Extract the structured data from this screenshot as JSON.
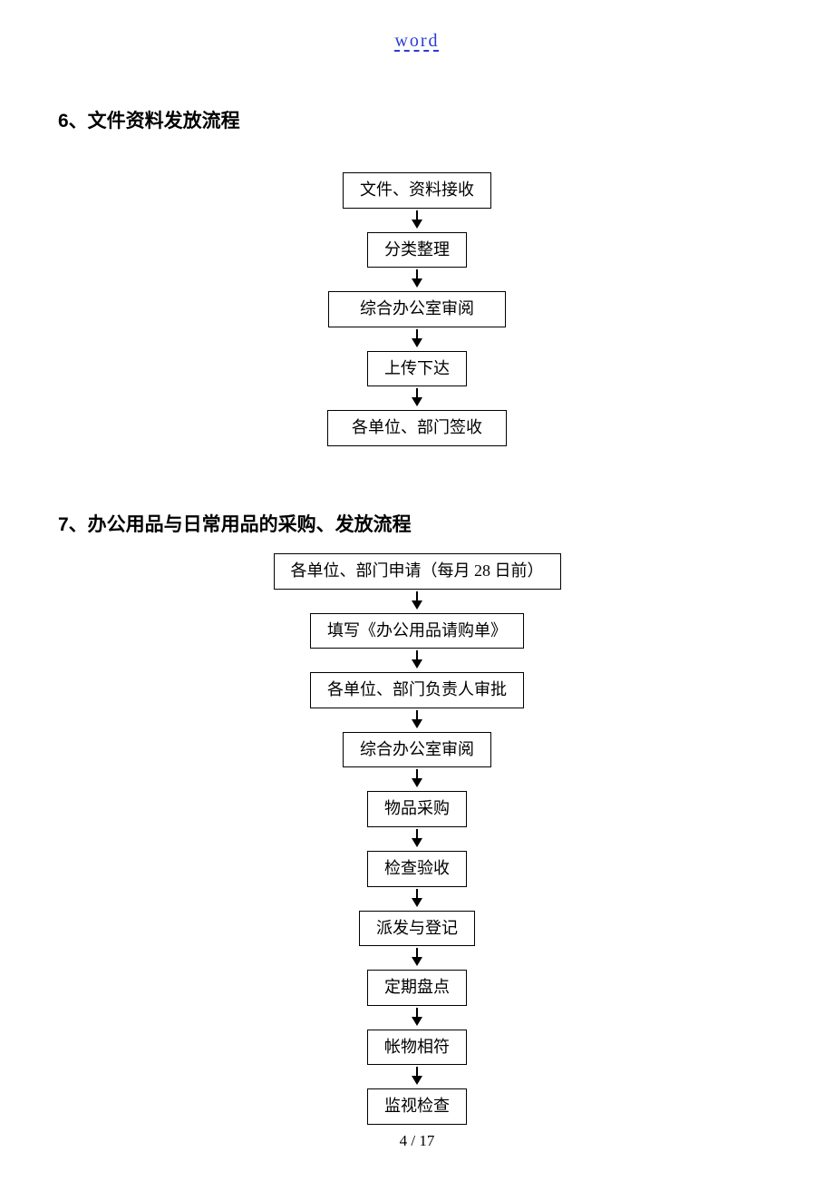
{
  "header": {
    "link": "word"
  },
  "section6": {
    "title": "6、文件资料发放流程",
    "steps": [
      "文件、资料接收",
      "分类整理",
      "综合办公室审阅",
      "上传下达",
      "各单位、部门签收"
    ]
  },
  "section7": {
    "title": "7、办公用品与日常用品的采购、发放流程",
    "steps": [
      "各单位、部门申请（每月 28 日前）",
      "填写《办公用品请购单》",
      "各单位、部门负责人审批",
      "综合办公室审阅",
      "物品采购",
      "检查验收",
      "派发与登记",
      "定期盘点",
      "帐物相符",
      "监视检查"
    ]
  },
  "footer": {
    "page": "4 / 17"
  },
  "chart_data": [
    {
      "type": "flowchart",
      "title": "文件资料发放流程",
      "nodes": [
        "文件、资料接收",
        "分类整理",
        "综合办公室审阅",
        "上传下达",
        "各单位、部门签收"
      ],
      "edges": [
        [
          0,
          1
        ],
        [
          1,
          2
        ],
        [
          2,
          3
        ],
        [
          3,
          4
        ]
      ]
    },
    {
      "type": "flowchart",
      "title": "办公用品与日常用品的采购、发放流程",
      "nodes": [
        "各单位、部门申请（每月 28 日前）",
        "填写《办公用品请购单》",
        "各单位、部门负责人审批",
        "综合办公室审阅",
        "物品采购",
        "检查验收",
        "派发与登记",
        "定期盘点",
        "帐物相符",
        "监视检查"
      ],
      "edges": [
        [
          0,
          1
        ],
        [
          1,
          2
        ],
        [
          2,
          3
        ],
        [
          3,
          4
        ],
        [
          4,
          5
        ],
        [
          5,
          6
        ],
        [
          6,
          7
        ],
        [
          7,
          8
        ],
        [
          8,
          9
        ]
      ]
    }
  ]
}
